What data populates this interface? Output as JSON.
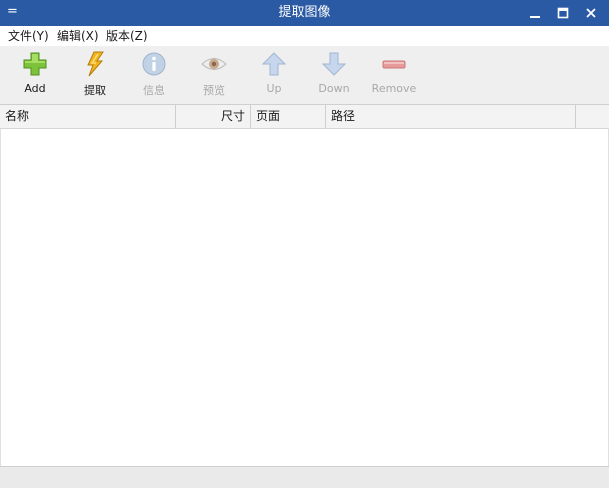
{
  "window": {
    "sysmenu": "=",
    "title": "提取图像"
  },
  "menubar": {
    "items": [
      "文件(Y)",
      "编辑(X)",
      "版本(Z)"
    ]
  },
  "toolbar": {
    "add": "Add",
    "extract": "提取",
    "info": "信息",
    "preview": "预览",
    "up": "Up",
    "down": "Down",
    "remove": "Remove"
  },
  "columns": {
    "name": "名称",
    "size": "尺寸",
    "page": "页面",
    "path": "路径"
  },
  "colors": {
    "titlebar": "#2a5aa3",
    "toolbar_bg": "#efefef",
    "add_green": "#7cc23a",
    "disabled_gray": "#a8a8a8"
  }
}
